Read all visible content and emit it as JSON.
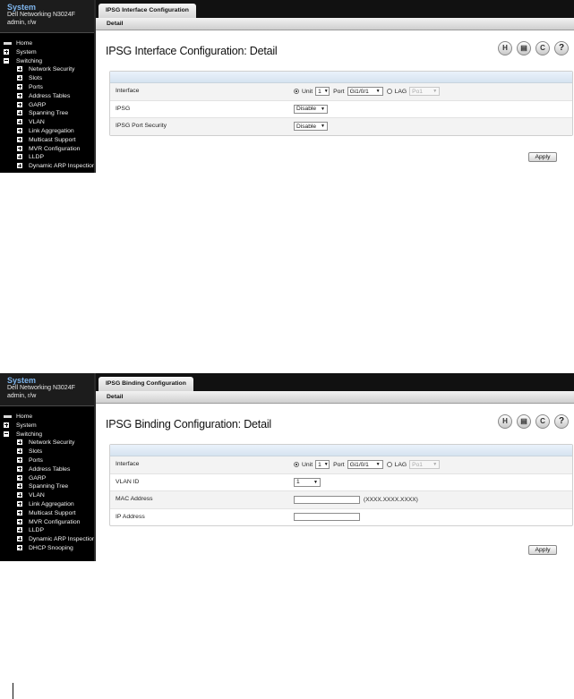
{
  "nav_header": {
    "system": "System",
    "model": "Dell Networking N3024F",
    "user": "admin, r/w"
  },
  "nav": {
    "home": "Home",
    "system": "System",
    "switching": "Switching",
    "network_security": "Network Security",
    "slots": "Slots",
    "ports": "Ports",
    "address_tables": "Address Tables",
    "garp": "GARP",
    "spanning_tree": "Spanning Tree",
    "vlan": "VLAN",
    "link_aggregation": "Link Aggregation",
    "multicast_support": "Multicast Support",
    "mvr_configuration": "MVR Configuration",
    "lldp": "LLDP",
    "dynamic_arp_inspection": "Dynamic ARP Inspection",
    "dhcp_snooping": "DHCP Snooping"
  },
  "icons": [
    "save-icon",
    "print-icon",
    "refresh-icon",
    "help-icon",
    "tree-expand-icon",
    "tree-collapse-icon",
    "home-icon"
  ],
  "common": {
    "detail_tab": "Detail",
    "apply": "Apply",
    "interface_label": "Interface",
    "unit_label": "Unit",
    "unit_value": "1",
    "port_label": "Port",
    "port_value": "Gi1/0/1",
    "lag_label": "LAG",
    "lag_value": "Po1",
    "save_glyph": "H",
    "print_glyph": "▤",
    "refresh_glyph": "C",
    "help_glyph": "?",
    "caret": "▼"
  },
  "screen1": {
    "tab": "IPSG Interface Configuration",
    "title": "IPSG Interface Configuration: Detail",
    "ipsg_label": "IPSG",
    "ipsg_value": "Disable",
    "port_security_label": "IPSG Port Security",
    "port_security_value": "Disable"
  },
  "screen2": {
    "tab": "IPSG Binding Configuration",
    "title": "IPSG Binding Configuration: Detail",
    "vlan_label": "VLAN ID",
    "vlan_value": "1",
    "mac_label": "MAC Address",
    "mac_value": "",
    "mac_hint": "(XXXX.XXXX.XXXX)",
    "ip_label": "IP Address",
    "ip_value": ""
  }
}
